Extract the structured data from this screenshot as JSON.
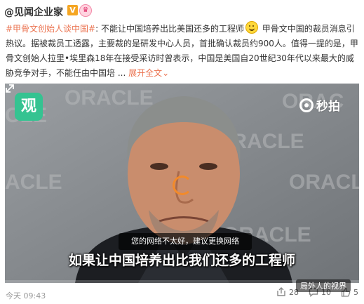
{
  "post": {
    "username": "@见闻企业家",
    "hashtag": "#甲骨文创始人谈中国#",
    "text_after_hashtag": ": 不能让中国培养出比美国还多的工程师",
    "body": " 甲骨文中国的裁员消息引热议。据被裁员工透露，主要裁的是研发中心人员，首批确认裁员约900人。值得一提的是，甲骨文创始人拉里•埃里森18年在接受采访时曾表示，中国是美国自20世纪30年代以来最大的威胁竞争对手，不能任由中国培",
    "ellipsis": " ...",
    "expand_label": "展开全文",
    "expand_arrow": "⌄"
  },
  "video": {
    "channel_logo_text": "观",
    "miaopai_text": "秒拍",
    "network_tip": "您的网络不太好，建议更换网络",
    "subtitle": "如果让中国培养出比我们还多的工程师",
    "brand_wall_text": "ORACLE"
  },
  "footer": {
    "time": "今天 09:43",
    "share_count": "28",
    "comment_count": "10",
    "like_count": "5",
    "watermark": "局外人的视界"
  },
  "colors": {
    "link_orange": "#eb7350",
    "logo_green": "#35c391"
  }
}
